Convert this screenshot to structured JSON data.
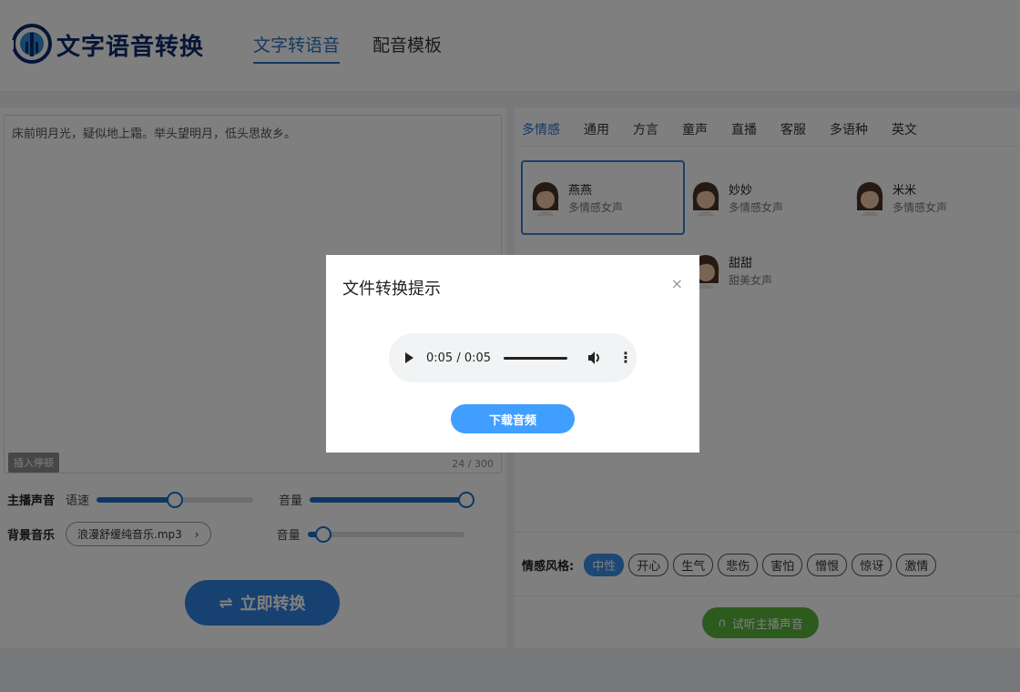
{
  "header": {
    "logo_text": "文字语音转换",
    "nav": [
      {
        "label": "文字转语音",
        "active": true
      },
      {
        "label": "配音模板",
        "active": false
      }
    ]
  },
  "editor": {
    "text": "床前明月光，疑似地上霜。举头望明月，低头思故乡。",
    "insert_pause_label": "插入停顿",
    "char_count": "24 / 300"
  },
  "controls": {
    "host_voice_label": "主播声音",
    "speed_label": "语速",
    "speed_value": 0.5,
    "volume_label": "音量",
    "host_volume_value": 1.0,
    "bgm_label": "背景音乐",
    "bgm_file": "浪漫舒缓纯音乐.mp3",
    "bgm_volume_label": "音量",
    "bgm_volume_value": 0.1,
    "convert_label": "立即转换"
  },
  "voices": {
    "tabs": [
      "多情感",
      "通用",
      "方言",
      "童声",
      "直播",
      "客服",
      "多语种",
      "英文"
    ],
    "active_tab": "多情感",
    "items": [
      {
        "name": "燕燕",
        "desc": "多情感女声",
        "selected": true
      },
      {
        "name": "妙妙",
        "desc": "多情感女声",
        "selected": false
      },
      {
        "name": "米米",
        "desc": "多情感女声",
        "selected": false
      },
      {
        "name": "甜甜",
        "desc": "甜美女声",
        "selected": false
      }
    ],
    "emotion_label": "情感风格:",
    "emotions": [
      "中性",
      "开心",
      "生气",
      "悲伤",
      "害怕",
      "憎恨",
      "惊讶",
      "激情"
    ],
    "active_emotion": "中性",
    "listen_label": "试听主播声音"
  },
  "dialog": {
    "title": "文件转换提示",
    "close_glyph": "×",
    "audio_time": "0:05 / 0:05",
    "download_label": "下载音频"
  },
  "colors": {
    "accent": "#2c72c4",
    "download": "#409eff",
    "listen": "#5bb53b"
  }
}
